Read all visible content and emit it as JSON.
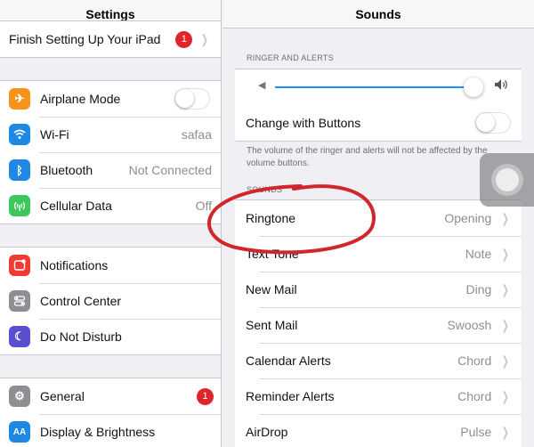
{
  "left_pane": {
    "title": "Settings",
    "setup_row": {
      "label": "Finish Setting Up Your iPad",
      "badge": "1"
    },
    "connectivity": [
      {
        "label": "Airplane Mode",
        "icon": "airplane-icon",
        "icon_color": "#f7931a",
        "glyph": "✈",
        "value": "",
        "control": "switch-off"
      },
      {
        "label": "Wi-Fi",
        "icon": "wifi-icon",
        "icon_color": "#1e88e5",
        "glyph": "◠",
        "value": "safaa"
      },
      {
        "label": "Bluetooth",
        "icon": "bluetooth-icon",
        "icon_color": "#1e88e5",
        "glyph": "ᛒ",
        "value": "Not Connected"
      },
      {
        "label": "Cellular Data",
        "icon": "cellular-data-icon",
        "icon_color": "#3ec75a",
        "glyph": "⊛",
        "value": "Off"
      }
    ],
    "notifications_group": [
      {
        "label": "Notifications",
        "icon": "notifications-icon",
        "icon_color": "#ee3b34",
        "glyph": "■"
      },
      {
        "label": "Control Center",
        "icon": "control-center-icon",
        "icon_color": "#8e8e93",
        "glyph": "☰"
      },
      {
        "label": "Do Not Disturb",
        "icon": "do-not-disturb-icon",
        "icon_color": "#5b4fd1",
        "glyph": "☾"
      }
    ],
    "general_group": [
      {
        "label": "General",
        "icon": "general-gear-icon",
        "icon_color": "#8e8e93",
        "glyph": "⚙",
        "badge": "1"
      },
      {
        "label": "Display & Brightness",
        "icon": "display-brightness-icon",
        "icon_color": "#1e88e5",
        "glyph": "AA"
      }
    ]
  },
  "right_pane": {
    "title": "Sounds",
    "ringer_header": "RINGER AND ALERTS",
    "volume_fraction": 0.96,
    "change_with_buttons": {
      "label": "Change with Buttons",
      "state": "off"
    },
    "ringer_footer": "The volume of the ringer and alerts will not be affected by the volume buttons.",
    "sounds_header": "SOUNDS",
    "sounds": [
      {
        "label": "Ringtone",
        "value": "Opening"
      },
      {
        "label": "Text Tone",
        "value": "Note"
      },
      {
        "label": "New Mail",
        "value": "Ding"
      },
      {
        "label": "Sent Mail",
        "value": "Swoosh"
      },
      {
        "label": "Calendar Alerts",
        "value": "Chord"
      },
      {
        "label": "Reminder Alerts",
        "value": "Chord"
      },
      {
        "label": "AirDrop",
        "value": "Pulse"
      }
    ]
  },
  "overlay": {
    "assistive_touch_icon": "assistive-touch-icon",
    "annotation": "red-hand-drawn-circle",
    "annotation_color": "#d0262c"
  }
}
